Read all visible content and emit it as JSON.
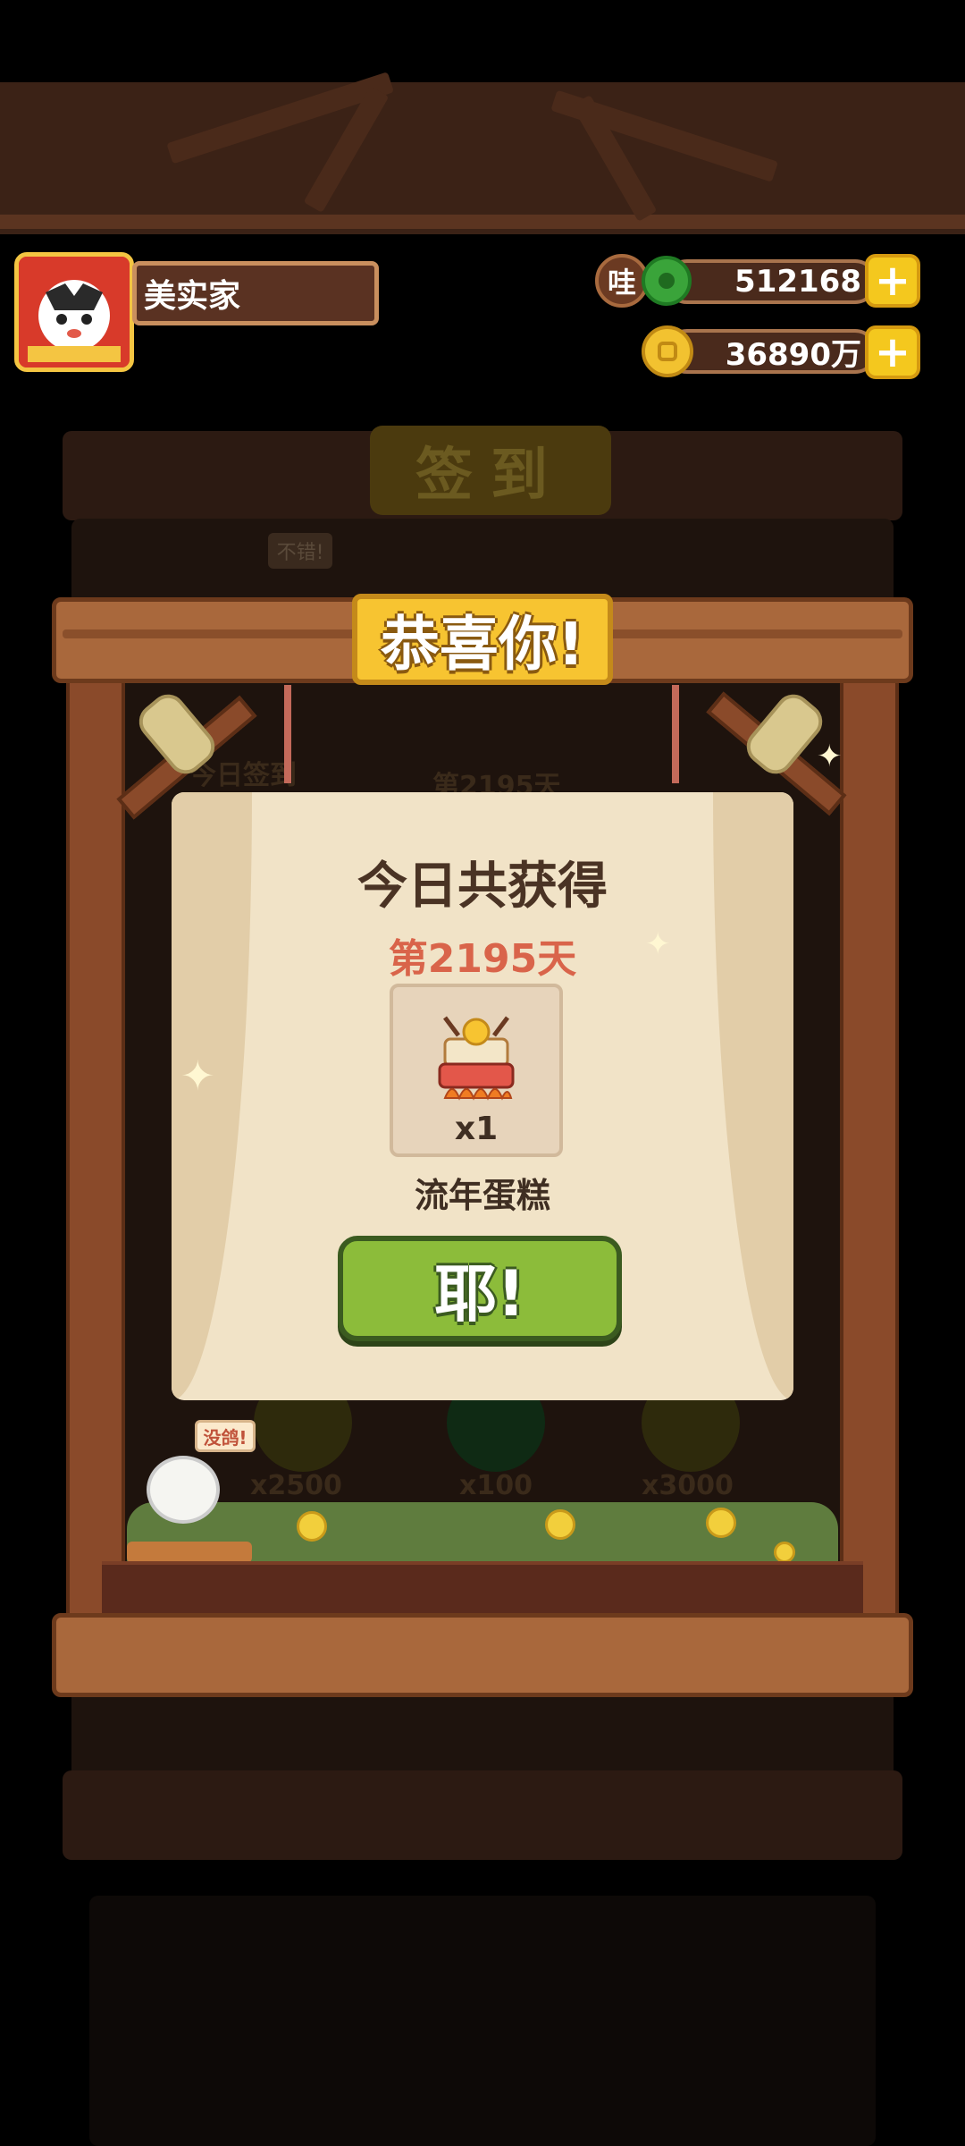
{
  "header": {
    "player_name": "美实家",
    "wa_label": "哇",
    "jade_amount": "512168",
    "coin_amount": "36890万",
    "plus_label": "+"
  },
  "background": {
    "board_title": "签到",
    "chick_bubble_top": "不错!",
    "today_label": "今日签到",
    "day_label_bg": "第2195天",
    "rewards": [
      "x2500",
      "x100",
      "x3000"
    ]
  },
  "popup": {
    "title": "恭喜你!",
    "heading": "今日共获得",
    "day": "第2195天",
    "item_count": "x1",
    "item_name": "流年蛋糕",
    "confirm_label": "耶!",
    "chick_bubble": "没鸽!"
  },
  "colors": {
    "frame_wood": "#a9683c",
    "title_gold": "#f7c431",
    "card_bg": "#f1e3c7",
    "confirm_green": "#8cbc3a",
    "day_red": "#d9644a"
  },
  "icons": [
    "avatar",
    "wa-badge-icon",
    "jade-icon",
    "coin-icon",
    "plus-icon",
    "cake-icon",
    "sparkle-icon",
    "chick-icon"
  ]
}
